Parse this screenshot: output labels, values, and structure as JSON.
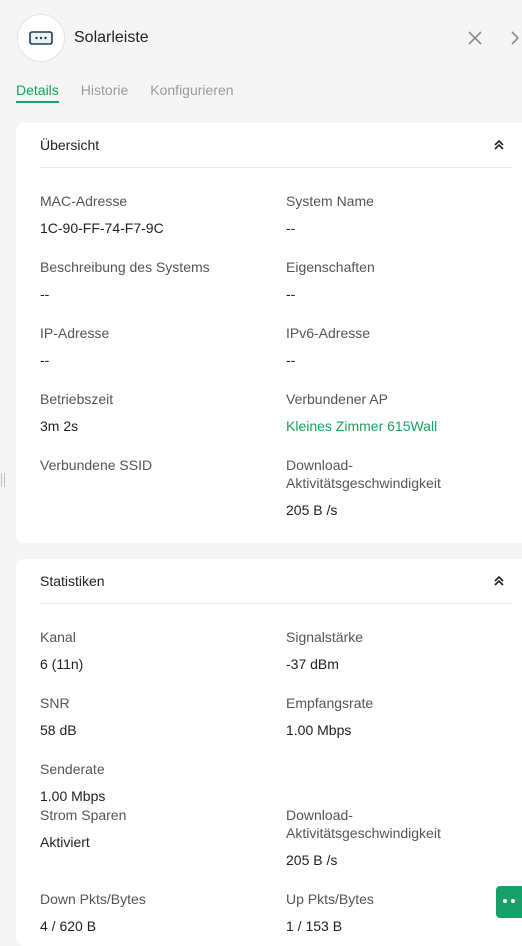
{
  "header": {
    "title": "Solarleiste",
    "icons": {
      "device": "device-icon",
      "close": "close-icon",
      "next": "chevron-right-icon"
    }
  },
  "tabs": [
    {
      "label": "Details",
      "active": true
    },
    {
      "label": "Historie",
      "active": false
    },
    {
      "label": "Konfigurieren",
      "active": false
    }
  ],
  "overview": {
    "title": "Übersicht",
    "fields": {
      "mac": {
        "label": "MAC-Adresse",
        "value": "1C-90-FF-74-F7-9C"
      },
      "system_name": {
        "label": "System Name",
        "value": "--"
      },
      "description": {
        "label": "Beschreibung des Systems",
        "value": "--"
      },
      "properties": {
        "label": "Eigenschaften",
        "value": "--"
      },
      "ip": {
        "label": "IP-Adresse",
        "value": "--"
      },
      "ipv6": {
        "label": "IPv6-Adresse",
        "value": "--"
      },
      "uptime": {
        "label": "Betriebszeit",
        "value": "3m 2s"
      },
      "connected_ap": {
        "label": "Verbundener AP",
        "value": "Kleines Zimmer 615Wall"
      },
      "ssid": {
        "label": "Verbundene SSID",
        "value": ""
      },
      "download_activity": {
        "label_1": "Download-",
        "label_2": "Aktivitätsgeschwindigkeit",
        "value": "205 B /s"
      }
    }
  },
  "statistics": {
    "title": "Statistiken",
    "fields": {
      "channel": {
        "label": "Kanal",
        "value": "6 (11n)"
      },
      "signal": {
        "label": "Signalstärke",
        "value": "-37 dBm"
      },
      "snr": {
        "label": "SNR",
        "value": "58 dB"
      },
      "rx_rate": {
        "label": "Empfangsrate",
        "value": "1.00 Mbps"
      },
      "tx_rate": {
        "label": "Senderate",
        "value": "1.00 Mbps"
      },
      "power_save": {
        "label": "Strom Sparen",
        "value": "Aktiviert"
      },
      "download_activity": {
        "label_1": "Download-",
        "label_2": "Aktivitätsgeschwindigkeit",
        "value": "205 B /s"
      },
      "down_pkts": {
        "label": "Down Pkts/Bytes",
        "value": "4 / 620 B"
      },
      "up_pkts": {
        "label": "Up Pkts/Bytes",
        "value": "1 / 153 B"
      }
    }
  },
  "colors": {
    "accent": "#1aa260",
    "chat": "#17a06a",
    "background": "#f5f5f5"
  }
}
